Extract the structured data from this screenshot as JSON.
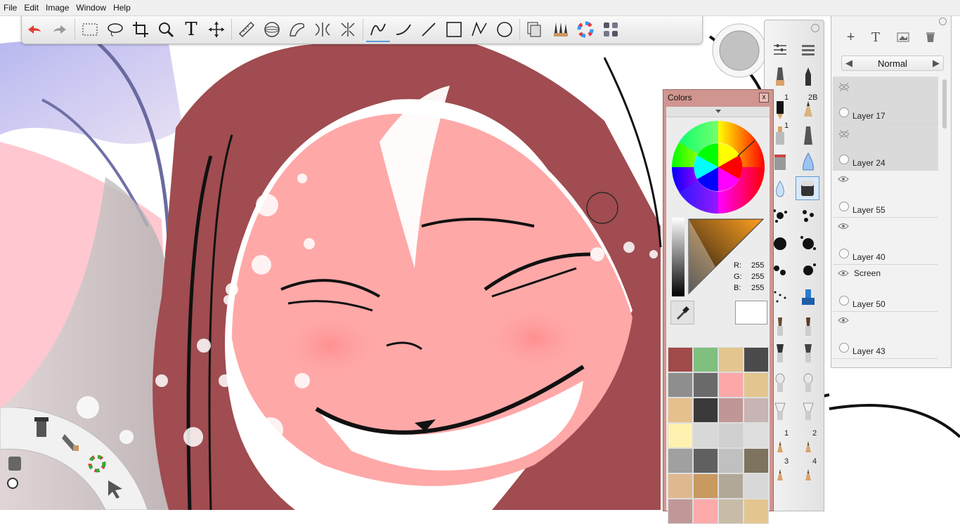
{
  "menu": [
    "File",
    "Edit",
    "Image",
    "Window",
    "Help"
  ],
  "toolbar": {
    "items": [
      {
        "name": "undo-icon"
      },
      {
        "name": "redo-icon"
      },
      {
        "name": "select-rect-icon"
      },
      {
        "name": "lasso-icon"
      },
      {
        "name": "crop-icon"
      },
      {
        "name": "zoom-icon"
      },
      {
        "name": "text-tool-icon",
        "glyph": "T"
      },
      {
        "name": "move-icon"
      },
      {
        "name": "ruler-icon"
      },
      {
        "name": "ellipse-guide-icon"
      },
      {
        "name": "french-curve-icon"
      },
      {
        "name": "symmetry-icon"
      },
      {
        "name": "perspective-icon"
      },
      {
        "name": "freehand-stroke-icon",
        "active": true
      },
      {
        "name": "curve-stroke-icon"
      },
      {
        "name": "line-icon"
      },
      {
        "name": "rectangle-icon"
      },
      {
        "name": "polyline-icon"
      },
      {
        "name": "circle-icon"
      },
      {
        "name": "layers-icon"
      },
      {
        "name": "brush-palette-icon"
      },
      {
        "name": "color-wheel-icon"
      },
      {
        "name": "copic-icon"
      }
    ]
  },
  "colors_panel": {
    "title": "Colors",
    "close": "x",
    "rgb": {
      "r_label": "R:",
      "g_label": "G:",
      "b_label": "B:",
      "r": "255",
      "g": "255",
      "b": "255"
    },
    "swatches": [
      "#a04a4a",
      "#7fbf7f",
      "#e3c68f",
      "#4b4b4b",
      "#8e8e8e",
      "#6a6a6a",
      "#fca8a8",
      "#e3c68f",
      "#e6c08c",
      "#3a3a3a",
      "#c09696",
      "#c8b4b4",
      "#fff1b0",
      "#d8d8d8",
      "#d0d0d0",
      "#dedede",
      "#a0a0a0",
      "#606060",
      "#c0c0c0",
      "#7d735e",
      "#e0b890",
      "#c99a60",
      "#b0a898",
      "#d8d8d8",
      "#c09898",
      "#fcaaaa",
      "#c8bca8",
      "#e3c68f"
    ]
  },
  "brush_palette": {
    "labels": [
      "1",
      "2B",
      "1",
      "1",
      "2",
      "3",
      "4"
    ]
  },
  "layers_panel": {
    "blend_mode": "Normal",
    "layers": [
      {
        "name": "Layer 17",
        "mode": "",
        "selected": true,
        "visible": false
      },
      {
        "name": "Layer 24",
        "mode": "",
        "selected": true,
        "visible": false
      },
      {
        "name": "Layer 55",
        "mode": "",
        "selected": false,
        "visible": true
      },
      {
        "name": "Layer 40",
        "mode": "",
        "selected": false,
        "visible": true
      },
      {
        "name": "Layer 50",
        "mode": "Screen",
        "selected": false,
        "visible": true
      },
      {
        "name": "Layer 43",
        "mode": "",
        "selected": false,
        "visible": true
      }
    ]
  },
  "theme": {
    "accent": "#5b9bd5",
    "colors_panel_bg": "#d0958f",
    "skin": "#ffa8a8",
    "hair": "#a04c50"
  }
}
